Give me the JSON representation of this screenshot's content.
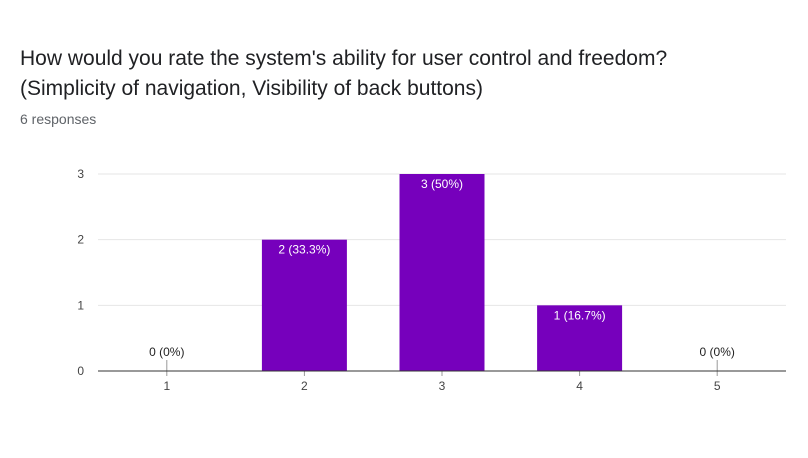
{
  "header": {
    "title": "How would you rate the system's ability for user control and freedom?\n(Simplicity of navigation, Visibility of back buttons)",
    "responses": "6 responses"
  },
  "colors": {
    "bar": "#7600bc",
    "grid": "#e6e6e6",
    "axis": "#333333",
    "label_inside": "#ffffff",
    "label_outside": "#222222"
  },
  "chart_data": {
    "type": "bar",
    "categories": [
      "1",
      "2",
      "3",
      "4",
      "5"
    ],
    "values": [
      0,
      2,
      3,
      1,
      0
    ],
    "data_labels": [
      "0 (0%)",
      "2 (33.3%)",
      "3 (50%)",
      "1 (16.7%)",
      "0 (0%)"
    ],
    "yticks": [
      0,
      1,
      2,
      3
    ],
    "ylim": [
      0,
      3
    ],
    "grid": true,
    "legend": "none"
  }
}
